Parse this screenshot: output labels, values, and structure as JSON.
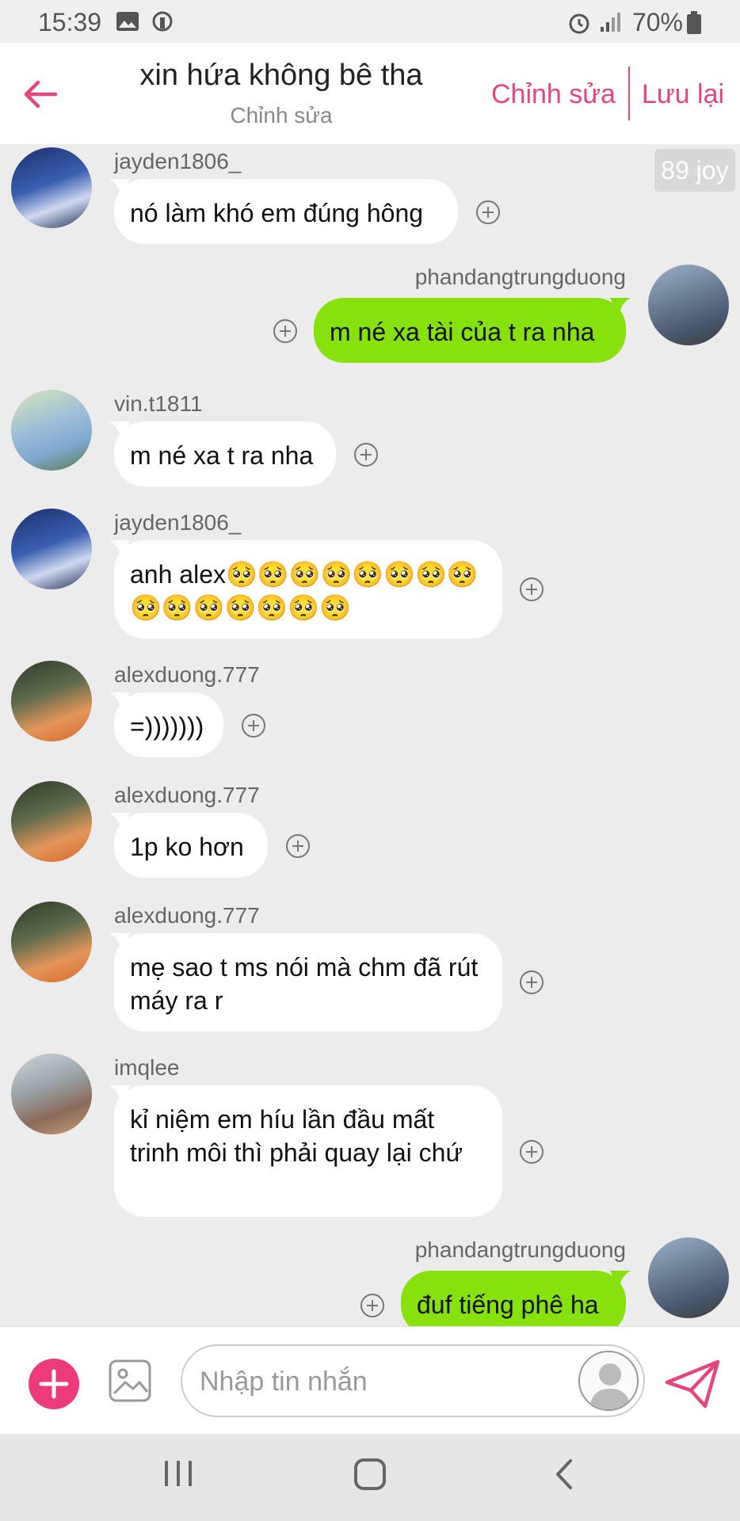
{
  "status_bar": {
    "time": "15:39",
    "battery": "70%"
  },
  "header": {
    "title": "xin hứa không bê tha",
    "subtitle": "Chỉnh sửa",
    "edit_label": "Chỉnh sửa",
    "save_label": "Lưu lại"
  },
  "badge": {
    "label": "89 joy"
  },
  "messages": [
    {
      "user": "jayden1806_",
      "text": "nó làm khó em đúng hông"
    },
    {
      "user": "phandangtrungduong",
      "text": "m né xa tài của t ra nha"
    },
    {
      "user": "vin.t1811",
      "text": "m né xa t ra nha"
    },
    {
      "user": "jayden1806_",
      "text": "anh alex🥺🥺🥺🥺🥺🥺🥺🥺🥺🥺🥺🥺🥺🥺🥺"
    },
    {
      "user": "alexduong.777",
      "text": "=)))))))"
    },
    {
      "user": "alexduong.777",
      "text": "1p ko hơn"
    },
    {
      "user": "alexduong.777",
      "text": "mẹ sao t ms nói mà chm đã rút máy ra r"
    },
    {
      "user": "imqlee",
      "text": "kỉ niệm em híu lần đầu mất trinh môi thì phải quay lại chứ"
    },
    {
      "user": "phandangtrungduong",
      "text": "đuf tiếng phê ha"
    }
  ],
  "composer": {
    "placeholder": "Nhập tin nhắn"
  },
  "colors": {
    "accent": "#e4457c",
    "outgoing_bubble": "#86e10d",
    "incoming_bubble": "#ffffff"
  },
  "icons": [
    "back-arrow-icon",
    "plus-circle-icon",
    "image-icon",
    "sticker-icon",
    "send-icon",
    "alarm-icon",
    "signal-icon",
    "battery-icon"
  ]
}
